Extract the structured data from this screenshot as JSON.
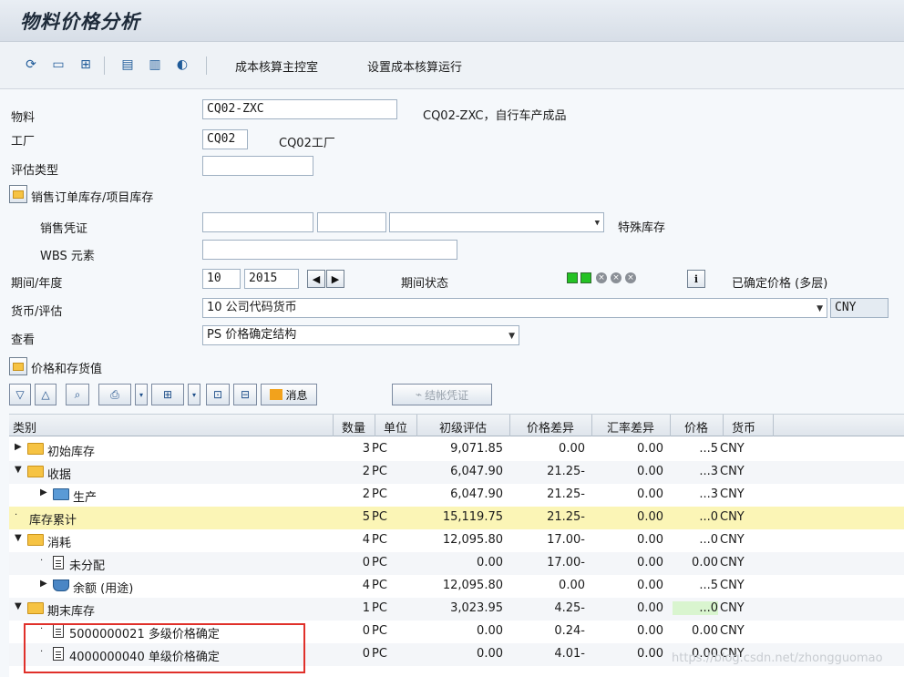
{
  "window": {
    "title": "物料价格分析"
  },
  "toolbar": {
    "icons": [
      "refresh-icon",
      "display-icon",
      "hierarchy-icon",
      "cost-icon",
      "columns-icon",
      "sound-icon"
    ],
    "links": [
      "成本核算主控室",
      "设置成本核算运行"
    ]
  },
  "form": {
    "material": {
      "label": "物料",
      "value": "CQ02-ZXC",
      "description": "CQ02-ZXC，自行车产成品"
    },
    "plant": {
      "label": "工厂",
      "value": "CQ02",
      "description": "CQ02工厂"
    },
    "valuation_type": {
      "label": "评估类型",
      "value": ""
    },
    "sales_order_stock": {
      "label": "销售订单库存/项目库存"
    },
    "sales_document": {
      "label": "销售凭证",
      "value1": "",
      "value2": "",
      "value3": "",
      "special_stock_label": "特殊库存"
    },
    "wbs": {
      "label": "WBS 元素",
      "value": ""
    },
    "period_year": {
      "label": "期间/年度",
      "period": "10",
      "year": "2015",
      "status_label": "期间状态",
      "info_label": "已确定价格 (多层)"
    },
    "currency_valuation": {
      "label": "货币/评估",
      "value": "10 公司代码货币",
      "currency": "CNY"
    },
    "view": {
      "label": "查看",
      "value": "PS 价格确定结构"
    },
    "prices_section": {
      "label": "价格和存货值"
    }
  },
  "alv_toolbar": {
    "message_label": "消息",
    "closing_doc_label": "结帐凭证"
  },
  "grid": {
    "headers": [
      "类别",
      "数量",
      "单位",
      "初级评估",
      "价格差异",
      "汇率差异",
      "价格",
      "货币"
    ],
    "rows": [
      {
        "level": 0,
        "expand": "▶",
        "icon": "folder",
        "label": "初始库存",
        "qty": "3",
        "unit": "PC",
        "primary": "9,071.85",
        "price_diff": "0.00",
        "fx_diff": "0.00",
        "price": "...5",
        "curr": "CNY"
      },
      {
        "level": 0,
        "expand": "▼",
        "icon": "folder-open",
        "label": "收据",
        "qty": "2",
        "unit": "PC",
        "primary": "6,047.90",
        "price_diff": "21.25-",
        "fx_diff": "0.00",
        "price": "...3",
        "curr": "CNY"
      },
      {
        "level": 1,
        "expand": "▶",
        "icon": "production",
        "label": "生产",
        "qty": "2",
        "unit": "PC",
        "primary": "6,047.90",
        "price_diff": "21.25-",
        "fx_diff": "0.00",
        "price": "...3",
        "curr": "CNY"
      },
      {
        "level": 0,
        "expand": "·",
        "icon": "none",
        "label": "库存累计",
        "qty": "5",
        "unit": "PC",
        "primary": "15,119.75",
        "price_diff": "21.25-",
        "fx_diff": "0.00",
        "price": "...0",
        "curr": "CNY"
      },
      {
        "level": 0,
        "expand": "▼",
        "icon": "folder-open",
        "label": "消耗",
        "qty": "4",
        "unit": "PC",
        "primary": "12,095.80",
        "price_diff": "17.00-",
        "fx_diff": "0.00",
        "price": "...0",
        "curr": "CNY"
      },
      {
        "level": 1,
        "expand": "·",
        "icon": "doc",
        "label": "未分配",
        "qty": "0",
        "unit": "PC",
        "primary": "0.00",
        "price_diff": "17.00-",
        "fx_diff": "0.00",
        "price": "0.00",
        "curr": "CNY"
      },
      {
        "level": 1,
        "expand": "▶",
        "icon": "tray",
        "label": "余额 (用途)",
        "qty": "4",
        "unit": "PC",
        "primary": "12,095.80",
        "price_diff": "0.00",
        "fx_diff": "0.00",
        "price": "...5",
        "curr": "CNY"
      },
      {
        "level": 0,
        "expand": "▼",
        "icon": "folder-open",
        "label": "期末库存",
        "qty": "1",
        "unit": "PC",
        "primary": "3,023.95",
        "price_diff": "4.25-",
        "fx_diff": "0.00",
        "price": "...0",
        "curr": "CNY"
      },
      {
        "level": 1,
        "expand": "·",
        "icon": "doc",
        "label": "5000000021 多级价格确定",
        "qty": "0",
        "unit": "PC",
        "primary": "0.00",
        "price_diff": "0.24-",
        "fx_diff": "0.00",
        "price": "0.00",
        "curr": "CNY"
      },
      {
        "level": 1,
        "expand": "·",
        "icon": "doc",
        "label": "4000000040 单级价格确定",
        "qty": "0",
        "unit": "PC",
        "primary": "0.00",
        "price_diff": "4.01-",
        "fx_diff": "0.00",
        "price": "0.00",
        "curr": "CNY"
      }
    ]
  },
  "watermark": "https://blog.csdn.net/zhongguomao"
}
